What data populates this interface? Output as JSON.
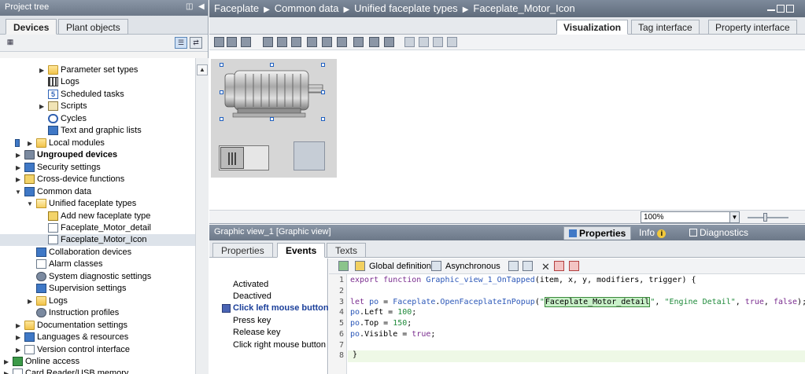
{
  "project_tree": {
    "title": "Project tree",
    "tabs": [
      "Devices",
      "Plant objects"
    ],
    "items": [
      {
        "label": "Parameter set types",
        "icon": "folder-icon"
      },
      {
        "label": "Logs",
        "icon": "logs-icon"
      },
      {
        "label": "Scheduled tasks",
        "icon": "task-icon",
        "icon_text": "5"
      },
      {
        "label": "Scripts",
        "icon": "script-icon"
      },
      {
        "label": "Cycles",
        "icon": "cycle-icon"
      },
      {
        "label": "Text and graphic lists",
        "icon": "list-icon"
      },
      {
        "label": "Local modules",
        "icon": "folder-icon"
      },
      {
        "label": "Ungrouped devices",
        "icon": "devices-icon"
      },
      {
        "label": "Security settings",
        "icon": "security-icon"
      },
      {
        "label": "Cross-device functions",
        "icon": "cross-device-icon"
      },
      {
        "label": "Common data",
        "icon": "common-data-icon"
      },
      {
        "label": "Unified faceplate types",
        "icon": "folder-open-icon"
      },
      {
        "label": "Add new faceplate type",
        "icon": "add-icon"
      },
      {
        "label": "Faceplate_Motor_detail",
        "icon": "faceplate-icon"
      },
      {
        "label": "Faceplate_Motor_Icon",
        "icon": "faceplate-icon"
      },
      {
        "label": "Collaboration devices",
        "icon": "collaboration-icon"
      },
      {
        "label": "Alarm classes",
        "icon": "alarm-icon"
      },
      {
        "label": "System diagnostic settings",
        "icon": "diagnostic-icon"
      },
      {
        "label": "Supervision settings",
        "icon": "supervision-icon"
      },
      {
        "label": "Logs",
        "icon": "folder-icon"
      },
      {
        "label": "Instruction profiles",
        "icon": "profile-icon"
      },
      {
        "label": "Documentation settings",
        "icon": "folder-icon"
      },
      {
        "label": "Languages & resources",
        "icon": "language-icon"
      },
      {
        "label": "Version control interface",
        "icon": "version-icon"
      },
      {
        "label": "Online access",
        "icon": "online-icon"
      },
      {
        "label": "Card Reader/USB memory",
        "icon": "card-reader-icon"
      }
    ]
  },
  "editor": {
    "breadcrumb": [
      "Faceplate",
      "Common data",
      "Unified faceplate types",
      "Faceplate_Motor_Icon"
    ],
    "tabs": [
      "Visualization",
      "Tag interface",
      "Property interface"
    ],
    "active_tab": "Visualization",
    "zoom": "100%"
  },
  "inspector": {
    "title": "Graphic view_1 [Graphic view]",
    "tabs": [
      "Properties",
      "Info",
      "Diagnostics"
    ],
    "sub_tabs": [
      "Properties",
      "Events",
      "Texts"
    ],
    "events": [
      "Activated",
      "Deactived",
      "Click left mouse button",
      "Press key",
      "Release key",
      "Click right mouse button"
    ],
    "active_event": "Click left mouse button",
    "toolbar": {
      "global_definition": "Global definition",
      "asynchronous": "Asynchronous"
    },
    "code_lines": [
      {
        "n": "1",
        "text": "export function Graphic_view_1_OnTapped(item, x, y, modifiers, trigger) {"
      },
      {
        "n": "2",
        "text": ""
      },
      {
        "n": "3",
        "text": "let po = Faceplate.OpenFaceplateInPopup(\"Faceplate_Motor_detail\", \"Engine Detail\", true, false);"
      },
      {
        "n": "4",
        "text": "po.Left = 100;"
      },
      {
        "n": "5",
        "text": "po.Top = 150;"
      },
      {
        "n": "6",
        "text": "po.Visible = true;"
      },
      {
        "n": "7",
        "text": ""
      },
      {
        "n": "8",
        "text": "}"
      }
    ]
  },
  "colors": {
    "title_bar": "#6c7888",
    "accent_blue": "#1f5fbf",
    "faceplate_bg": "#d6d6d6",
    "string_green": "#1e8a3a",
    "keyword_purple": "#7a2c8f"
  }
}
